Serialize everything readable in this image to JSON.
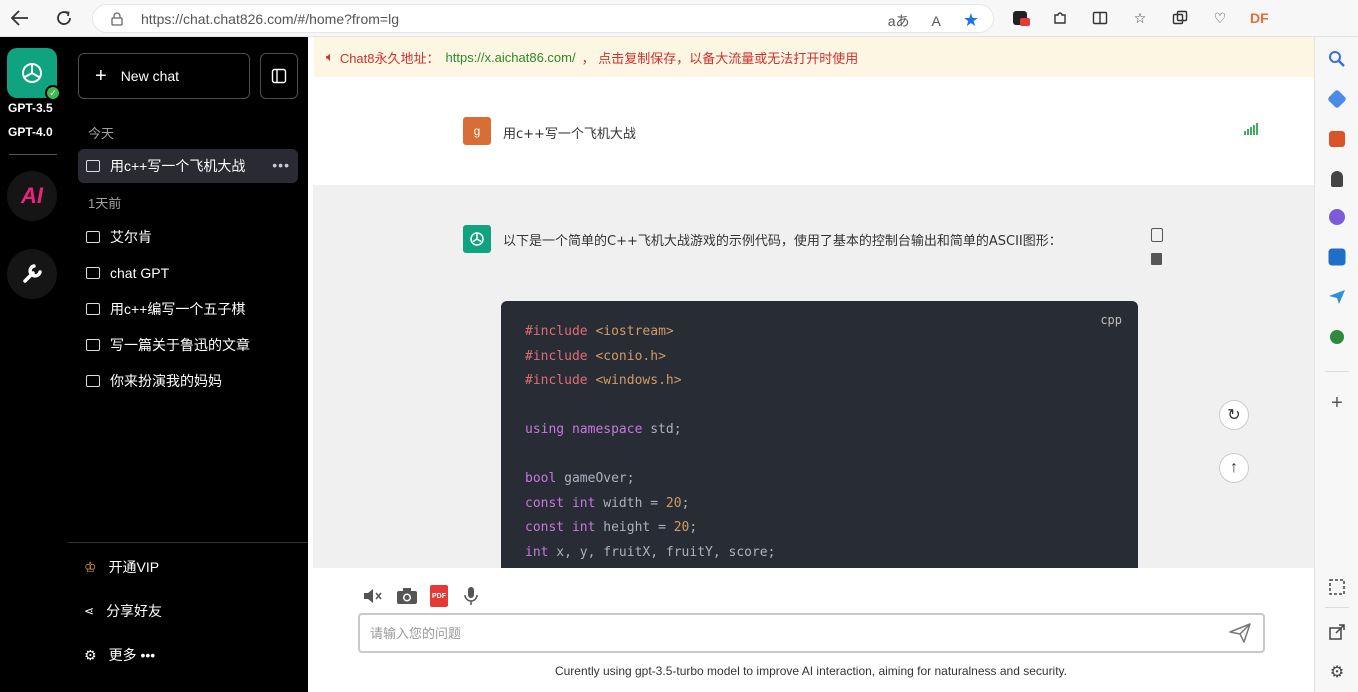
{
  "browser": {
    "url": "https://chat.chat826.com/#/home?from=lg",
    "read_aloud": "aあ",
    "text_size": "A",
    "ext_label": "DF"
  },
  "rail": {
    "model_a": "GPT-3.5",
    "model_b": "GPT-4.0",
    "ai_label": "AI"
  },
  "sidebar": {
    "new_chat": "New chat",
    "today_label": "今天",
    "yesterday_label": "1天前",
    "active_item": "用c++写一个飞机大战",
    "items": [
      "艾尔肯",
      "chat GPT",
      "用c++编写一个五子棋",
      "写一篇关于鲁迅的文章",
      "你来扮演我的妈妈"
    ],
    "vip": "开通VIP",
    "share": "分享好友",
    "more": "更多 •••"
  },
  "notice": {
    "prefix": "Chat8永久地址：",
    "link": "https://x.aichat86.com/",
    "suffix": "， 点击复制保存，以备大流量或无法打开时使用"
  },
  "conversation": {
    "user_avatar": "g",
    "user_message": "用c++写一个飞机大战",
    "bot_message": "以下是一个简单的C++飞机大战游戏的示例代码，使用了基本的控制台输出和简单的ASCII图形：",
    "code_lang": "cpp",
    "code_lines": [
      [
        "#include",
        " <iostream>"
      ],
      [
        "#include",
        " <conio.h>"
      ],
      [
        "#include",
        " <windows.h>"
      ],
      [
        "",
        ""
      ],
      [
        "using namespace",
        " std;"
      ],
      [
        "",
        ""
      ],
      [
        "bool",
        " gameOver;"
      ],
      [
        "const int",
        " width = ",
        "20",
        ";"
      ],
      [
        "const int",
        " height = ",
        "20",
        ";"
      ],
      [
        "int",
        " x, y, fruitX, fruitY, score;"
      ]
    ]
  },
  "input": {
    "placeholder": "请输入您的问题",
    "value": ""
  },
  "footer_note": "Curently using gpt-3.5-turbo model to improve AI interaction, aiming for naturalness and security.",
  "colors": {
    "accent": "#10a37f",
    "sidebar_bg": "#000000",
    "notice_text": "#d03030",
    "notice_link": "#2a8a2a",
    "user_avatar_bg": "#d86d35",
    "code_bg": "#282c34"
  }
}
